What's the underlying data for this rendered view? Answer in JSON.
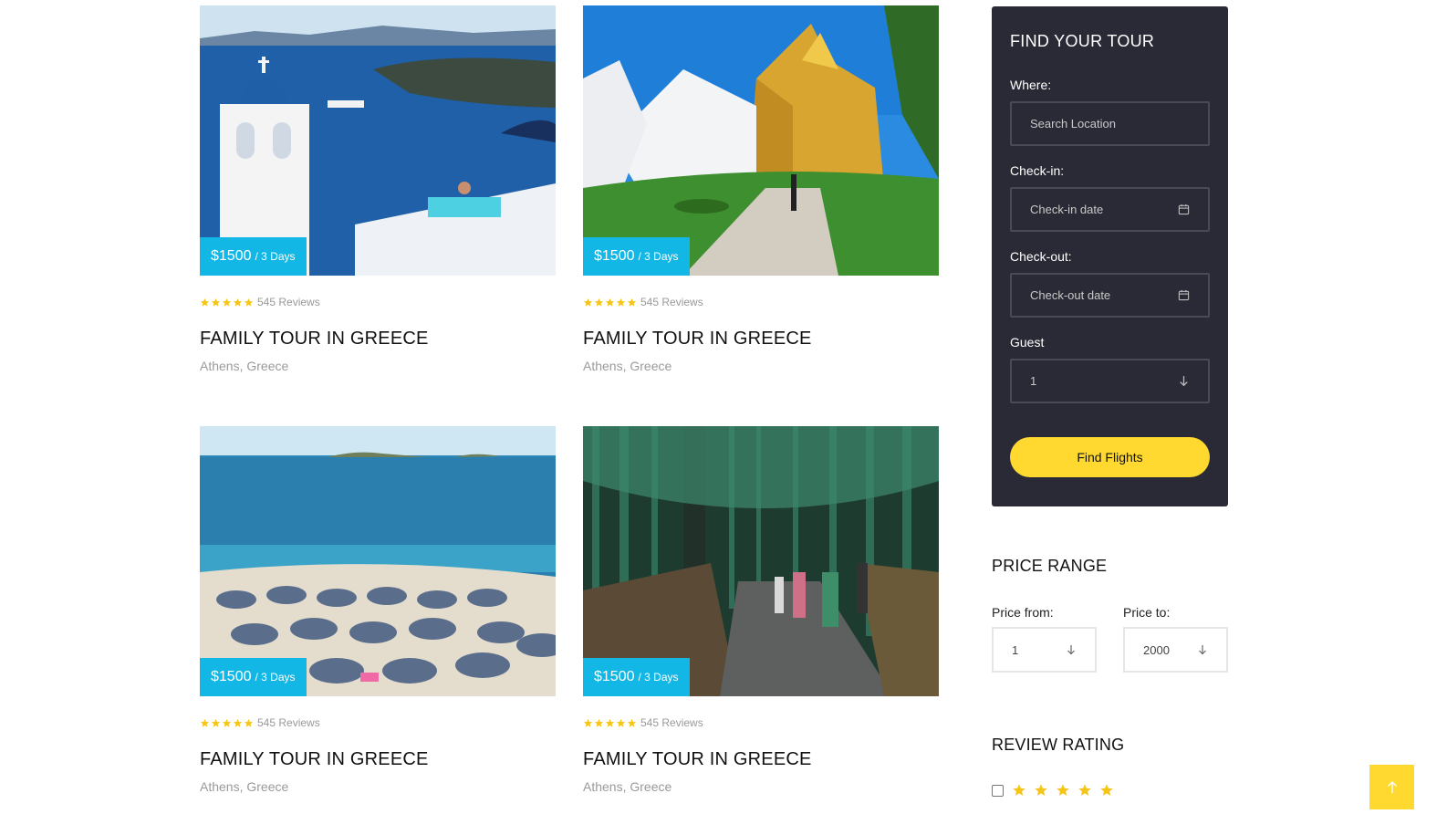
{
  "tours": [
    {
      "price": "$1500",
      "duration": "/ 3 Days",
      "reviews": "545 Reviews",
      "title": "FAMILY TOUR IN GREECE",
      "location": "Athens, Greece",
      "image": "santorini-church-photo"
    },
    {
      "price": "$1500",
      "duration": "/ 3 Days",
      "reviews": "545 Reviews",
      "title": "FAMILY TOUR IN GREECE",
      "location": "Athens, Greece",
      "image": "golden-temple-photo"
    },
    {
      "price": "$1500",
      "duration": "/ 3 Days",
      "reviews": "545 Reviews",
      "title": "FAMILY TOUR IN GREECE",
      "location": "Athens, Greece",
      "image": "beach-umbrellas-photo"
    },
    {
      "price": "$1500",
      "duration": "/ 3 Days",
      "reviews": "545 Reviews",
      "title": "FAMILY TOUR IN GREECE",
      "location": "Athens, Greece",
      "image": "bamboo-forest-photo"
    }
  ],
  "finder": {
    "title": "FIND YOUR TOUR",
    "where_label": "Where:",
    "where_placeholder": "Search Location",
    "checkin_label": "Check-in:",
    "checkin_placeholder": "Check-in date",
    "checkout_label": "Check-out:",
    "checkout_placeholder": "Check-out date",
    "guest_label": "Guest",
    "guest_value": "1",
    "button": "Find Flights"
  },
  "price_range": {
    "title": "PRICE RANGE",
    "from_label": "Price from:",
    "from_value": "1",
    "to_label": "Price to:",
    "to_value": "2000"
  },
  "review_rating": {
    "title": "REVIEW RATING",
    "stars": 5
  },
  "colors": {
    "price_badge": "#13b7e6",
    "accent_yellow": "#ffd92f",
    "finder_bg": "#2a2a36",
    "star": "#f5c518"
  }
}
